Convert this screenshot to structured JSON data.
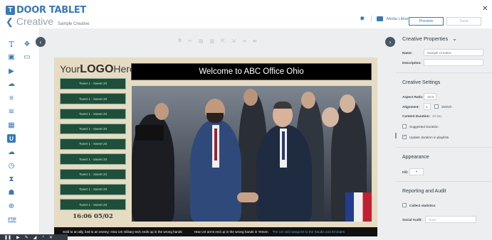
{
  "header": {
    "logo_letter": "T",
    "logo_text": "DOOR TABLET",
    "back_arrow": "❮",
    "title": "Creative",
    "subtitle": "Sample Creative",
    "media_library": "Media Library",
    "preview_label": "Preview",
    "save_label": "Save",
    "close_glyph": "✕"
  },
  "toolbox": {
    "items": [
      {
        "name": "text-tool-icon",
        "glyph": "T"
      },
      {
        "name": "widget-tool-icon",
        "glyph": "❖"
      },
      {
        "name": "image-tool-icon",
        "glyph": "▣"
      },
      {
        "name": "display-tool-icon",
        "glyph": "▭"
      },
      {
        "name": "video-tool-icon",
        "glyph": "▶"
      },
      {
        "name": "weather-tool-icon",
        "glyph": "☁"
      },
      {
        "name": "ticker-tool-icon",
        "glyph": "≡"
      },
      {
        "name": "rss-tool-icon",
        "glyph": "≋"
      },
      {
        "name": "calendar-tool-icon",
        "glyph": "▦"
      },
      {
        "name": "u-tool-icon",
        "glyph": "U"
      },
      {
        "name": "cloud-tool-icon",
        "glyph": "☁"
      },
      {
        "name": "clock-tool-icon",
        "glyph": "◷"
      },
      {
        "name": "timer-tool-icon",
        "glyph": "⧗"
      },
      {
        "name": "people-tool-icon",
        "glyph": "☗"
      },
      {
        "name": "globe-tool-icon",
        "glyph": "⊕"
      },
      {
        "name": "ftp-tool-icon",
        "glyph": "FTP"
      }
    ]
  },
  "canvas": {
    "collapse_glyph": "‹",
    "expand_glyph": "›",
    "logo_plain": "Your",
    "logo_bold": "LOGO",
    "logo_end": "Here",
    "banner": "Welcome to ABC Office Ohio",
    "tweets": [
      "Tweet 1 - Sweet 20",
      "Tweet 1 - Sweet 20",
      "Tweet 1 - Sweet 20",
      "Tweet 1 - Sweet 20",
      "Tweet 1 - Sweet 20",
      "Tweet 1 - Sweet 20",
      "Tweet 1 - Sweet 20",
      "Tweet 1 - Sweet 20",
      "Tweet 1 - Sweet 20"
    ],
    "clock": "16:06 05/02",
    "ticker_1": "Sold to an ally, lost to an enemy: How US military tech ends up in the wrong hands",
    "ticker_2": "How US arms end up in the wrong hands in Yemen",
    "ticker_3": "The US sold weapons to the Saudis and Emirates"
  },
  "panel": {
    "title": "Creative Properties",
    "chevron": "⌄",
    "name_label": "Name:",
    "name_value": "Sample Creative",
    "description_label": "Description:",
    "description_value": "",
    "settings_head": "Creative Settings",
    "aspect_label": "Aspect Ratio:",
    "aspect_value": "16:9",
    "alignment_label": "Alignment:",
    "alignment_value": "a",
    "stretch_label": "Stretch",
    "duration_label": "Content Duration:",
    "duration_value": "12 sec",
    "suggested_label": "Suggested Duration",
    "update_label": "Update duration in playlists",
    "appearance_head": "Appearance",
    "fill_label": "Fill:",
    "fill_value": "▾",
    "reporting_head": "Reporting and Audit",
    "collect_label": "Collect statistics",
    "social_label": "Social Audit:",
    "social_value": "None"
  }
}
